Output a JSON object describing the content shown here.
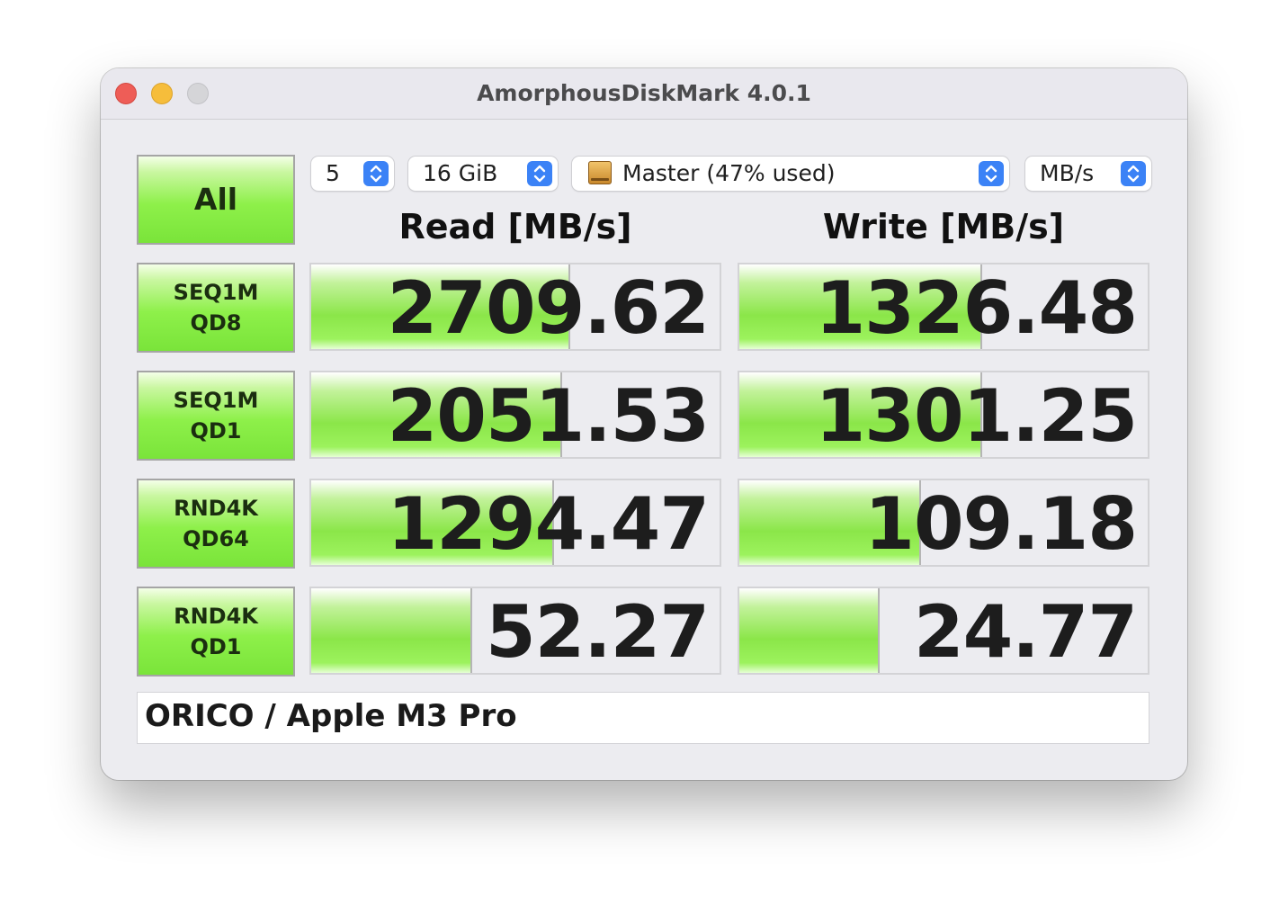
{
  "window": {
    "title": "AmorphousDiskMark 4.0.1"
  },
  "controls": {
    "all_label": "All",
    "count": "5",
    "size": "16 GiB",
    "drive": "Master (47% used)",
    "unit": "MB/s"
  },
  "headers": {
    "read": "Read [MB/s]",
    "write": "Write [MB/s]"
  },
  "tests": [
    {
      "line1": "SEQ1M",
      "line2": "QD8",
      "read": "2709.62",
      "write": "1326.48",
      "read_level": 0.63,
      "write_level": 0.59
    },
    {
      "line1": "SEQ1M",
      "line2": "QD1",
      "read": "2051.53",
      "write": "1301.25",
      "read_level": 0.61,
      "write_level": 0.59
    },
    {
      "line1": "RND4K",
      "line2": "QD64",
      "read": "1294.47",
      "write": "109.18",
      "read_level": 0.59,
      "write_level": 0.44
    },
    {
      "line1": "RND4K",
      "line2": "QD1",
      "read": "52.27",
      "write": "24.77",
      "read_level": 0.39,
      "write_level": 0.34
    }
  ],
  "footer": {
    "text": "ORICO / Apple M3 Pro"
  },
  "colors": {
    "bar_green": "#8be649",
    "stepper_blue": "#3b82f6",
    "close": "#ee5d57",
    "minimize": "#f6bd3b",
    "zoom": "#d5d5d8"
  }
}
